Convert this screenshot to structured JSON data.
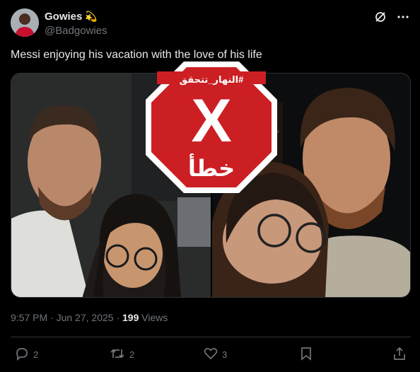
{
  "author": {
    "display_name": "Gowies",
    "badge_emoji": "💫",
    "handle": "@Badgowies"
  },
  "tweet": {
    "text": "Messi enjoying his vacation with the love of his life"
  },
  "stamp": {
    "top_label": "#النهار_تتحقق",
    "mark": "X",
    "bottom_label": "خطأ",
    "color": "#cc1f24"
  },
  "meta": {
    "time": "9:57 PM",
    "date": "Jun 27, 2025",
    "views_count": "199",
    "views_label": "Views"
  },
  "actions": {
    "replies": "2",
    "reposts": "2",
    "likes": "3"
  },
  "icons": [
    "grok-icon",
    "more-icon",
    "reply-icon",
    "repost-icon",
    "like-icon",
    "bookmark-icon",
    "share-icon"
  ]
}
